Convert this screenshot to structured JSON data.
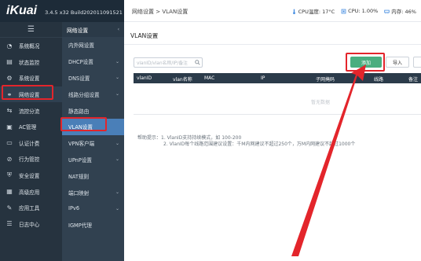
{
  "app": {
    "logo": "iKuai",
    "version": "3.4.5 x32 Build202011091521"
  },
  "header": {
    "breadcrumb": "网络设置 > VLAN设置",
    "cpu_temp": "CPU温度: 17°C",
    "cpu_usage": "CPU: 1.00%",
    "memory": "内存: 46%"
  },
  "sidebar": {
    "items": [
      {
        "label": "系统概况",
        "icon": "dashboard-icon"
      },
      {
        "label": "状态监控",
        "icon": "monitor-icon"
      },
      {
        "label": "系统设置",
        "icon": "gear-icon"
      },
      {
        "label": "网络设置",
        "icon": "network-icon"
      },
      {
        "label": "流控分流",
        "icon": "flow-icon"
      },
      {
        "label": "AC管理",
        "icon": "ac-icon"
      },
      {
        "label": "认证计费",
        "icon": "auth-icon"
      },
      {
        "label": "行为管控",
        "icon": "behavior-icon"
      },
      {
        "label": "安全设置",
        "icon": "shield-icon"
      },
      {
        "label": "高级应用",
        "icon": "advanced-icon"
      },
      {
        "label": "应用工具",
        "icon": "tools-icon"
      },
      {
        "label": "日志中心",
        "icon": "log-icon"
      }
    ]
  },
  "submenu": {
    "title": "网络设置",
    "items": [
      {
        "label": "内外网设置",
        "chevron": false
      },
      {
        "label": "DHCP设置",
        "chevron": true
      },
      {
        "label": "DNS设置",
        "chevron": true
      },
      {
        "label": "线路分组设置",
        "chevron": true
      },
      {
        "label": "静态路由",
        "chevron": false
      },
      {
        "label": "VLAN设置",
        "chevron": false
      },
      {
        "label": "VPN客户端",
        "chevron": true
      },
      {
        "label": "UPnP设置",
        "chevron": true
      },
      {
        "label": "NAT规则",
        "chevron": false
      },
      {
        "label": "端口映射",
        "chevron": true
      },
      {
        "label": "IPv6",
        "chevron": true
      },
      {
        "label": "IGMP代理",
        "chevron": false
      }
    ]
  },
  "main": {
    "title": "VLAN设置",
    "search_placeholder": "vlanID/vlan名称/IP/备注",
    "add_button": "添加",
    "import_button": "导入",
    "columns": [
      "vlanID",
      "vlan名称",
      "MAC",
      "IP",
      "子网掩码",
      "线路",
      "备注"
    ],
    "empty_text": "暂无数据",
    "tips_label": "帮助提示：",
    "tips": [
      "1. VlanID支持持续模式，如 100-200",
      "2. VlanID每个线路范围建议设置：千M内网建议不超过250个，万M内网建议不超过1000个"
    ]
  },
  "colors": {
    "topbar": "#1d2b38",
    "sidebar": "#26333f",
    "submenu": "#314150",
    "active_sub": "#4a7fb8",
    "add_button": "#4aae7f",
    "annotation": "#e3252b"
  }
}
